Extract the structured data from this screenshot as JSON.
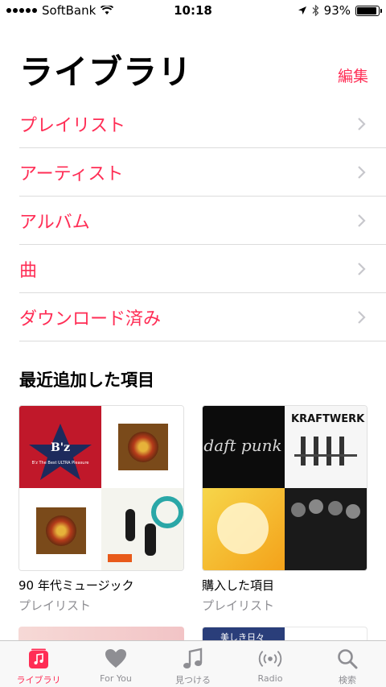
{
  "status": {
    "carrier": "SoftBank",
    "time": "10:18",
    "battery": "93%",
    "battery_level": 0.93
  },
  "header": {
    "title": "ライブラリ",
    "edit_label": "編集"
  },
  "menu": [
    {
      "label": "プレイリスト"
    },
    {
      "label": "アーティスト"
    },
    {
      "label": "アルバム"
    },
    {
      "label": "曲"
    },
    {
      "label": "ダウンロード済み"
    }
  ],
  "recent": {
    "title": "最近追加した項目",
    "items": [
      {
        "name": "90 年代ミュージック",
        "type": "プレイリスト",
        "cover1_text": "B'z",
        "cover1_sub": "B'z The Best ULTRA Pleasure"
      },
      {
        "name": "購入した項目",
        "type": "プレイリスト",
        "cover1_text": "daft punk",
        "cover2_text": "KRAFTWERK"
      }
    ],
    "peek_text": "美しき日々"
  },
  "tabs": [
    {
      "label": "ライブラリ",
      "icon": "library-icon",
      "active": true
    },
    {
      "label": "For You",
      "icon": "heart-icon",
      "active": false
    },
    {
      "label": "見つける",
      "icon": "music-note-icon",
      "active": false
    },
    {
      "label": "Radio",
      "icon": "radio-icon",
      "active": false
    },
    {
      "label": "検索",
      "icon": "search-icon",
      "active": false
    }
  ],
  "colors": {
    "accent": "#ff2d55",
    "secondary_text": "#8e8e93"
  }
}
